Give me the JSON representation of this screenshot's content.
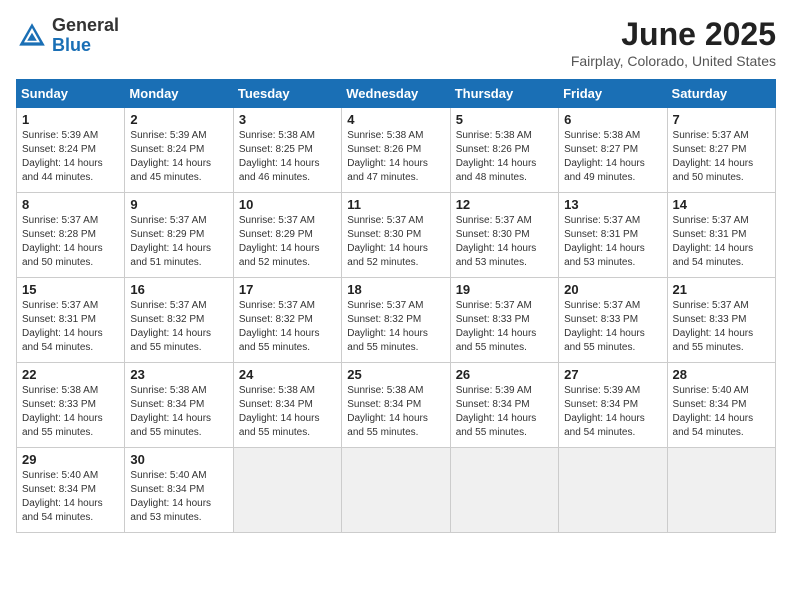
{
  "header": {
    "logo_general": "General",
    "logo_blue": "Blue",
    "month_title": "June 2025",
    "location": "Fairplay, Colorado, United States"
  },
  "calendar": {
    "days_of_week": [
      "Sunday",
      "Monday",
      "Tuesday",
      "Wednesday",
      "Thursday",
      "Friday",
      "Saturday"
    ],
    "weeks": [
      [
        null,
        {
          "day": "2",
          "sunrise": "Sunrise: 5:39 AM",
          "sunset": "Sunset: 8:24 PM",
          "daylight": "Daylight: 14 hours and 45 minutes."
        },
        {
          "day": "3",
          "sunrise": "Sunrise: 5:38 AM",
          "sunset": "Sunset: 8:25 PM",
          "daylight": "Daylight: 14 hours and 46 minutes."
        },
        {
          "day": "4",
          "sunrise": "Sunrise: 5:38 AM",
          "sunset": "Sunset: 8:26 PM",
          "daylight": "Daylight: 14 hours and 47 minutes."
        },
        {
          "day": "5",
          "sunrise": "Sunrise: 5:38 AM",
          "sunset": "Sunset: 8:26 PM",
          "daylight": "Daylight: 14 hours and 48 minutes."
        },
        {
          "day": "6",
          "sunrise": "Sunrise: 5:38 AM",
          "sunset": "Sunset: 8:27 PM",
          "daylight": "Daylight: 14 hours and 49 minutes."
        },
        {
          "day": "7",
          "sunrise": "Sunrise: 5:37 AM",
          "sunset": "Sunset: 8:27 PM",
          "daylight": "Daylight: 14 hours and 50 minutes."
        }
      ],
      [
        {
          "day": "1",
          "sunrise": "Sunrise: 5:39 AM",
          "sunset": "Sunset: 8:24 PM",
          "daylight": "Daylight: 14 hours and 44 minutes."
        },
        {
          "day": "9",
          "sunrise": "Sunrise: 5:37 AM",
          "sunset": "Sunset: 8:29 PM",
          "daylight": "Daylight: 14 hours and 51 minutes."
        },
        {
          "day": "10",
          "sunrise": "Sunrise: 5:37 AM",
          "sunset": "Sunset: 8:29 PM",
          "daylight": "Daylight: 14 hours and 52 minutes."
        },
        {
          "day": "11",
          "sunrise": "Sunrise: 5:37 AM",
          "sunset": "Sunset: 8:30 PM",
          "daylight": "Daylight: 14 hours and 52 minutes."
        },
        {
          "day": "12",
          "sunrise": "Sunrise: 5:37 AM",
          "sunset": "Sunset: 8:30 PM",
          "daylight": "Daylight: 14 hours and 53 minutes."
        },
        {
          "day": "13",
          "sunrise": "Sunrise: 5:37 AM",
          "sunset": "Sunset: 8:31 PM",
          "daylight": "Daylight: 14 hours and 53 minutes."
        },
        {
          "day": "14",
          "sunrise": "Sunrise: 5:37 AM",
          "sunset": "Sunset: 8:31 PM",
          "daylight": "Daylight: 14 hours and 54 minutes."
        }
      ],
      [
        {
          "day": "8",
          "sunrise": "Sunrise: 5:37 AM",
          "sunset": "Sunset: 8:28 PM",
          "daylight": "Daylight: 14 hours and 50 minutes."
        },
        {
          "day": "16",
          "sunrise": "Sunrise: 5:37 AM",
          "sunset": "Sunset: 8:32 PM",
          "daylight": "Daylight: 14 hours and 55 minutes."
        },
        {
          "day": "17",
          "sunrise": "Sunrise: 5:37 AM",
          "sunset": "Sunset: 8:32 PM",
          "daylight": "Daylight: 14 hours and 55 minutes."
        },
        {
          "day": "18",
          "sunrise": "Sunrise: 5:37 AM",
          "sunset": "Sunset: 8:32 PM",
          "daylight": "Daylight: 14 hours and 55 minutes."
        },
        {
          "day": "19",
          "sunrise": "Sunrise: 5:37 AM",
          "sunset": "Sunset: 8:33 PM",
          "daylight": "Daylight: 14 hours and 55 minutes."
        },
        {
          "day": "20",
          "sunrise": "Sunrise: 5:37 AM",
          "sunset": "Sunset: 8:33 PM",
          "daylight": "Daylight: 14 hours and 55 minutes."
        },
        {
          "day": "21",
          "sunrise": "Sunrise: 5:37 AM",
          "sunset": "Sunset: 8:33 PM",
          "daylight": "Daylight: 14 hours and 55 minutes."
        }
      ],
      [
        {
          "day": "15",
          "sunrise": "Sunrise: 5:37 AM",
          "sunset": "Sunset: 8:31 PM",
          "daylight": "Daylight: 14 hours and 54 minutes."
        },
        {
          "day": "23",
          "sunrise": "Sunrise: 5:38 AM",
          "sunset": "Sunset: 8:34 PM",
          "daylight": "Daylight: 14 hours and 55 minutes."
        },
        {
          "day": "24",
          "sunrise": "Sunrise: 5:38 AM",
          "sunset": "Sunset: 8:34 PM",
          "daylight": "Daylight: 14 hours and 55 minutes."
        },
        {
          "day": "25",
          "sunrise": "Sunrise: 5:38 AM",
          "sunset": "Sunset: 8:34 PM",
          "daylight": "Daylight: 14 hours and 55 minutes."
        },
        {
          "day": "26",
          "sunrise": "Sunrise: 5:39 AM",
          "sunset": "Sunset: 8:34 PM",
          "daylight": "Daylight: 14 hours and 55 minutes."
        },
        {
          "day": "27",
          "sunrise": "Sunrise: 5:39 AM",
          "sunset": "Sunset: 8:34 PM",
          "daylight": "Daylight: 14 hours and 54 minutes."
        },
        {
          "day": "28",
          "sunrise": "Sunrise: 5:40 AM",
          "sunset": "Sunset: 8:34 PM",
          "daylight": "Daylight: 14 hours and 54 minutes."
        }
      ],
      [
        {
          "day": "22",
          "sunrise": "Sunrise: 5:38 AM",
          "sunset": "Sunset: 8:33 PM",
          "daylight": "Daylight: 14 hours and 55 minutes."
        },
        {
          "day": "30",
          "sunrise": "Sunrise: 5:40 AM",
          "sunset": "Sunset: 8:34 PM",
          "daylight": "Daylight: 14 hours and 53 minutes."
        },
        null,
        null,
        null,
        null,
        null
      ],
      [
        {
          "day": "29",
          "sunrise": "Sunrise: 5:40 AM",
          "sunset": "Sunset: 8:34 PM",
          "daylight": "Daylight: 14 hours and 54 minutes."
        },
        null,
        null,
        null,
        null,
        null,
        null
      ]
    ]
  }
}
